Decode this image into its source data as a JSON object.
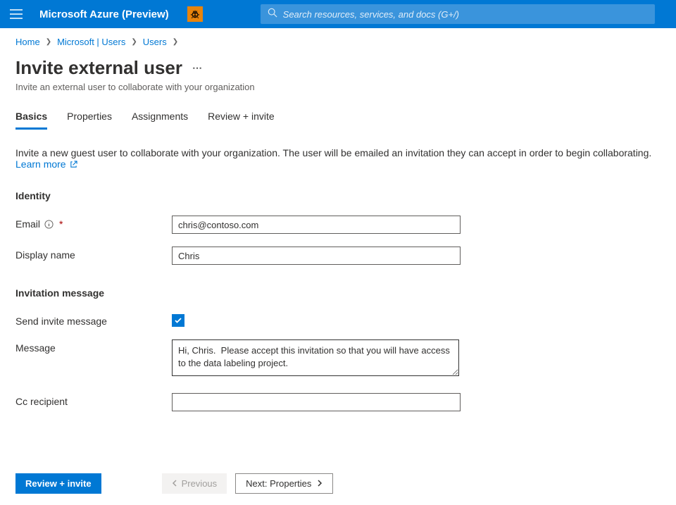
{
  "header": {
    "brand": "Microsoft Azure (Preview)",
    "search_placeholder": "Search resources, services, and docs (G+/)"
  },
  "breadcrumb": {
    "items": [
      "Home",
      "Microsoft | Users",
      "Users"
    ]
  },
  "page": {
    "title": "Invite external user",
    "subtitle": "Invite an external user to collaborate with your organization"
  },
  "tabs": {
    "items": [
      {
        "label": "Basics",
        "active": true
      },
      {
        "label": "Properties",
        "active": false
      },
      {
        "label": "Assignments",
        "active": false
      },
      {
        "label": "Review + invite",
        "active": false
      }
    ]
  },
  "intro": {
    "text": "Invite a new guest user to collaborate with your organization. The user will be emailed an invitation they can accept in order to begin collaborating. ",
    "learn_more": "Learn more"
  },
  "sections": {
    "identity": {
      "header": "Identity",
      "email_label": "Email",
      "email_value": "chris@contoso.com",
      "display_name_label": "Display name",
      "display_name_value": "Chris"
    },
    "invitation": {
      "header": "Invitation message",
      "send_invite_label": "Send invite message",
      "send_invite_checked": true,
      "message_label": "Message",
      "message_value": "Hi, Chris.  Please accept this invitation so that you will have access to the data labeling project.",
      "cc_label": "Cc recipient",
      "cc_value": ""
    }
  },
  "footer": {
    "review_invite": "Review + invite",
    "previous": "Previous",
    "next": "Next: Properties"
  }
}
